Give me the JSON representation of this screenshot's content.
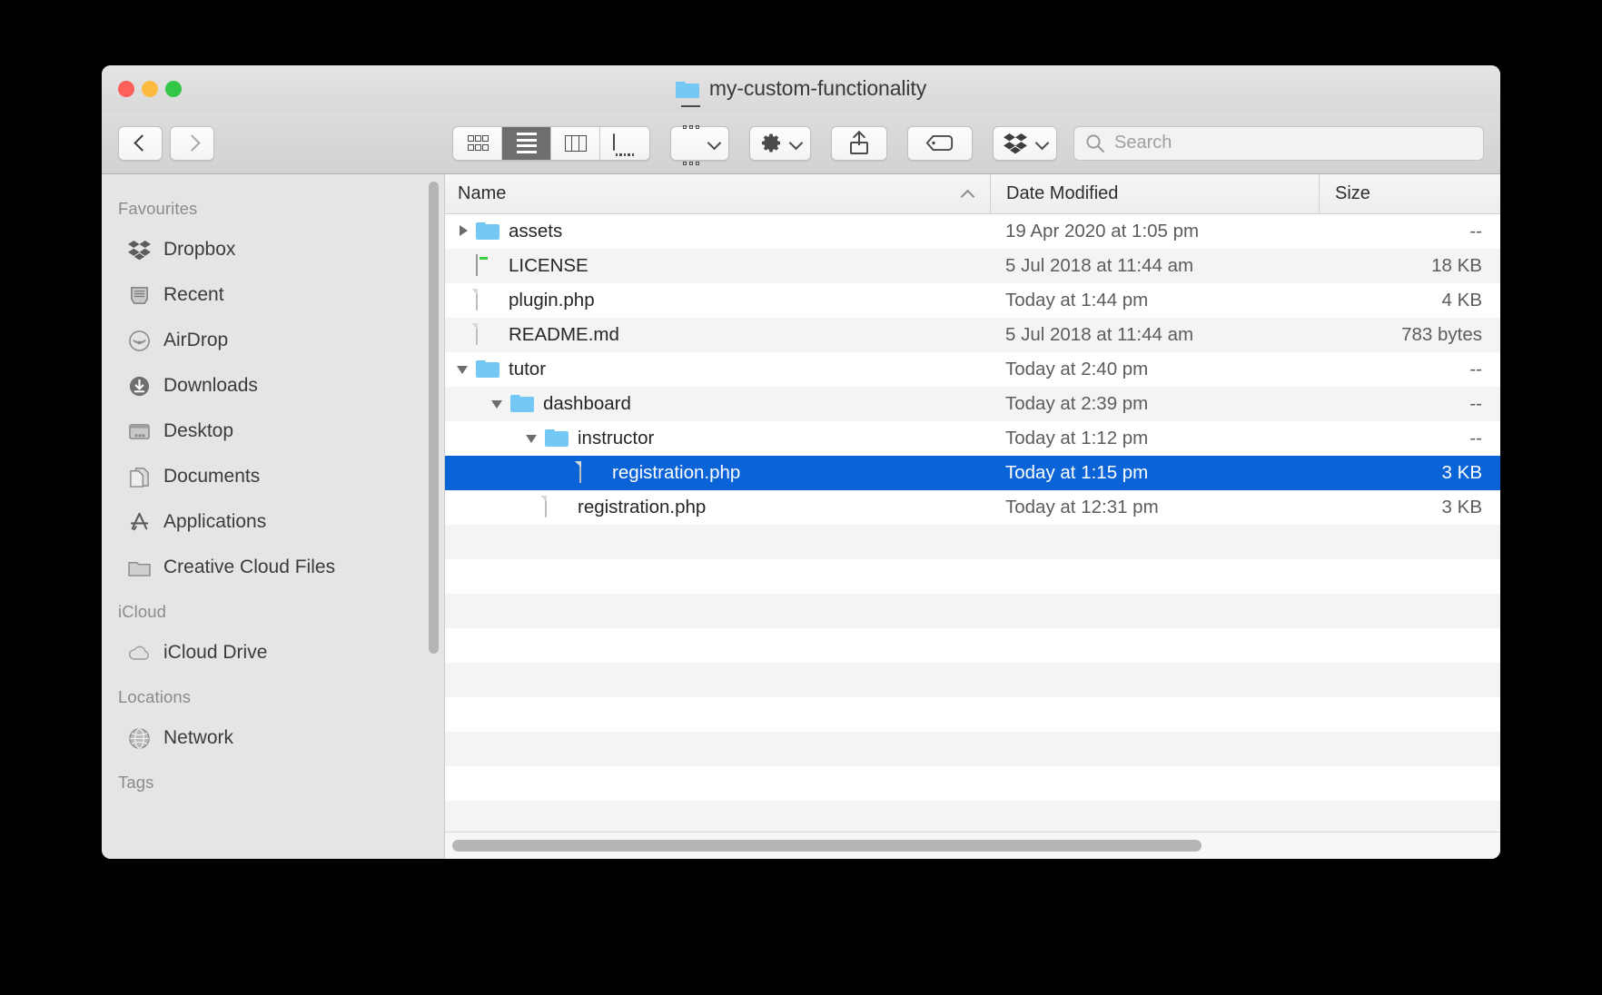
{
  "window": {
    "title": "my-custom-functionality",
    "title_icon": "folder-icon",
    "traffic_lights": [
      {
        "name": "close-button",
        "color": "#fc6058"
      },
      {
        "name": "minimize-button",
        "color": "#fcbb40"
      },
      {
        "name": "maximize-button",
        "color": "#33c748"
      }
    ]
  },
  "toolbar": {
    "back_icon": "chevron-left-icon",
    "forward_icon": "chevron-right-icon",
    "view_modes": [
      {
        "name": "icon-view",
        "icon": "grid-icon",
        "active": false
      },
      {
        "name": "list-view",
        "icon": "list-icon",
        "active": true
      },
      {
        "name": "column-view",
        "icon": "columns-icon",
        "active": false
      },
      {
        "name": "gallery-view",
        "icon": "coverflow-icon",
        "active": false
      }
    ],
    "arrange_icon": "arrange-grid-icon",
    "action_icon": "gear-icon",
    "share_icon": "share-icon",
    "tag_icon": "tag-icon",
    "dropbox_icon": "dropbox-icon",
    "chevron_icon": "chevron-down-icon",
    "search_placeholder": "Search",
    "search_value": "",
    "search_icon": "search-icon"
  },
  "sidebar": {
    "sections": [
      {
        "header": "Favourites",
        "items": [
          {
            "label": "Dropbox",
            "icon": "dropbox-icon"
          },
          {
            "label": "Recent",
            "icon": "recent-clock-icon"
          },
          {
            "label": "AirDrop",
            "icon": "airdrop-icon"
          },
          {
            "label": "Downloads",
            "icon": "downloads-icon"
          },
          {
            "label": "Desktop",
            "icon": "desktop-icon"
          },
          {
            "label": "Documents",
            "icon": "documents-icon"
          },
          {
            "label": "Applications",
            "icon": "applications-icon"
          },
          {
            "label": "Creative Cloud Files",
            "icon": "folder-icon"
          }
        ]
      },
      {
        "header": "iCloud",
        "items": [
          {
            "label": "iCloud Drive",
            "icon": "cloud-icon"
          }
        ]
      },
      {
        "header": "Locations",
        "items": [
          {
            "label": "Network",
            "icon": "globe-icon"
          }
        ]
      },
      {
        "header": "Tags",
        "items": []
      }
    ]
  },
  "file_list": {
    "columns": [
      {
        "label": "Name",
        "sorted": "ascending",
        "sort_icon": "caret-up-icon"
      },
      {
        "label": "Date Modified",
        "sorted": ""
      },
      {
        "label": "Size",
        "sorted": ""
      }
    ],
    "rows": [
      {
        "name": "assets",
        "date": "19 Apr 2020 at 1:05 pm",
        "size": "--",
        "icon": "folder-icon",
        "disclosure": "closed",
        "depth": 1,
        "selected": false
      },
      {
        "name": "LICENSE",
        "date": "5 Jul 2018 at 11:44 am",
        "size": "18 KB",
        "icon": "unix-executable-icon",
        "disclosure": "none",
        "depth": 1,
        "selected": false
      },
      {
        "name": "plugin.php",
        "date": "Today at 1:44 pm",
        "size": "4 KB",
        "icon": "document-icon",
        "disclosure": "none",
        "depth": 1,
        "selected": false
      },
      {
        "name": "README.md",
        "date": "5 Jul 2018 at 11:44 am",
        "size": "783 bytes",
        "icon": "document-icon",
        "disclosure": "none",
        "depth": 1,
        "selected": false
      },
      {
        "name": "tutor",
        "date": "Today at 2:40 pm",
        "size": "--",
        "icon": "folder-icon",
        "disclosure": "open",
        "depth": 1,
        "selected": false
      },
      {
        "name": "dashboard",
        "date": "Today at 2:39 pm",
        "size": "--",
        "icon": "folder-icon",
        "disclosure": "open",
        "depth": 2,
        "selected": false
      },
      {
        "name": "instructor",
        "date": "Today at 1:12 pm",
        "size": "--",
        "icon": "folder-icon",
        "disclosure": "open",
        "depth": 3,
        "selected": false
      },
      {
        "name": "registration.php",
        "date": "Today at 1:15 pm",
        "size": "3 KB",
        "icon": "document-icon",
        "disclosure": "none",
        "depth": 4,
        "selected": true
      },
      {
        "name": "registration.php",
        "date": "Today at 12:31 pm",
        "size": "3 KB",
        "icon": "document-icon",
        "disclosure": "none",
        "depth": 3,
        "selected": false
      }
    ],
    "selection_color": "#0a64d8",
    "empty_row_count": 9
  }
}
